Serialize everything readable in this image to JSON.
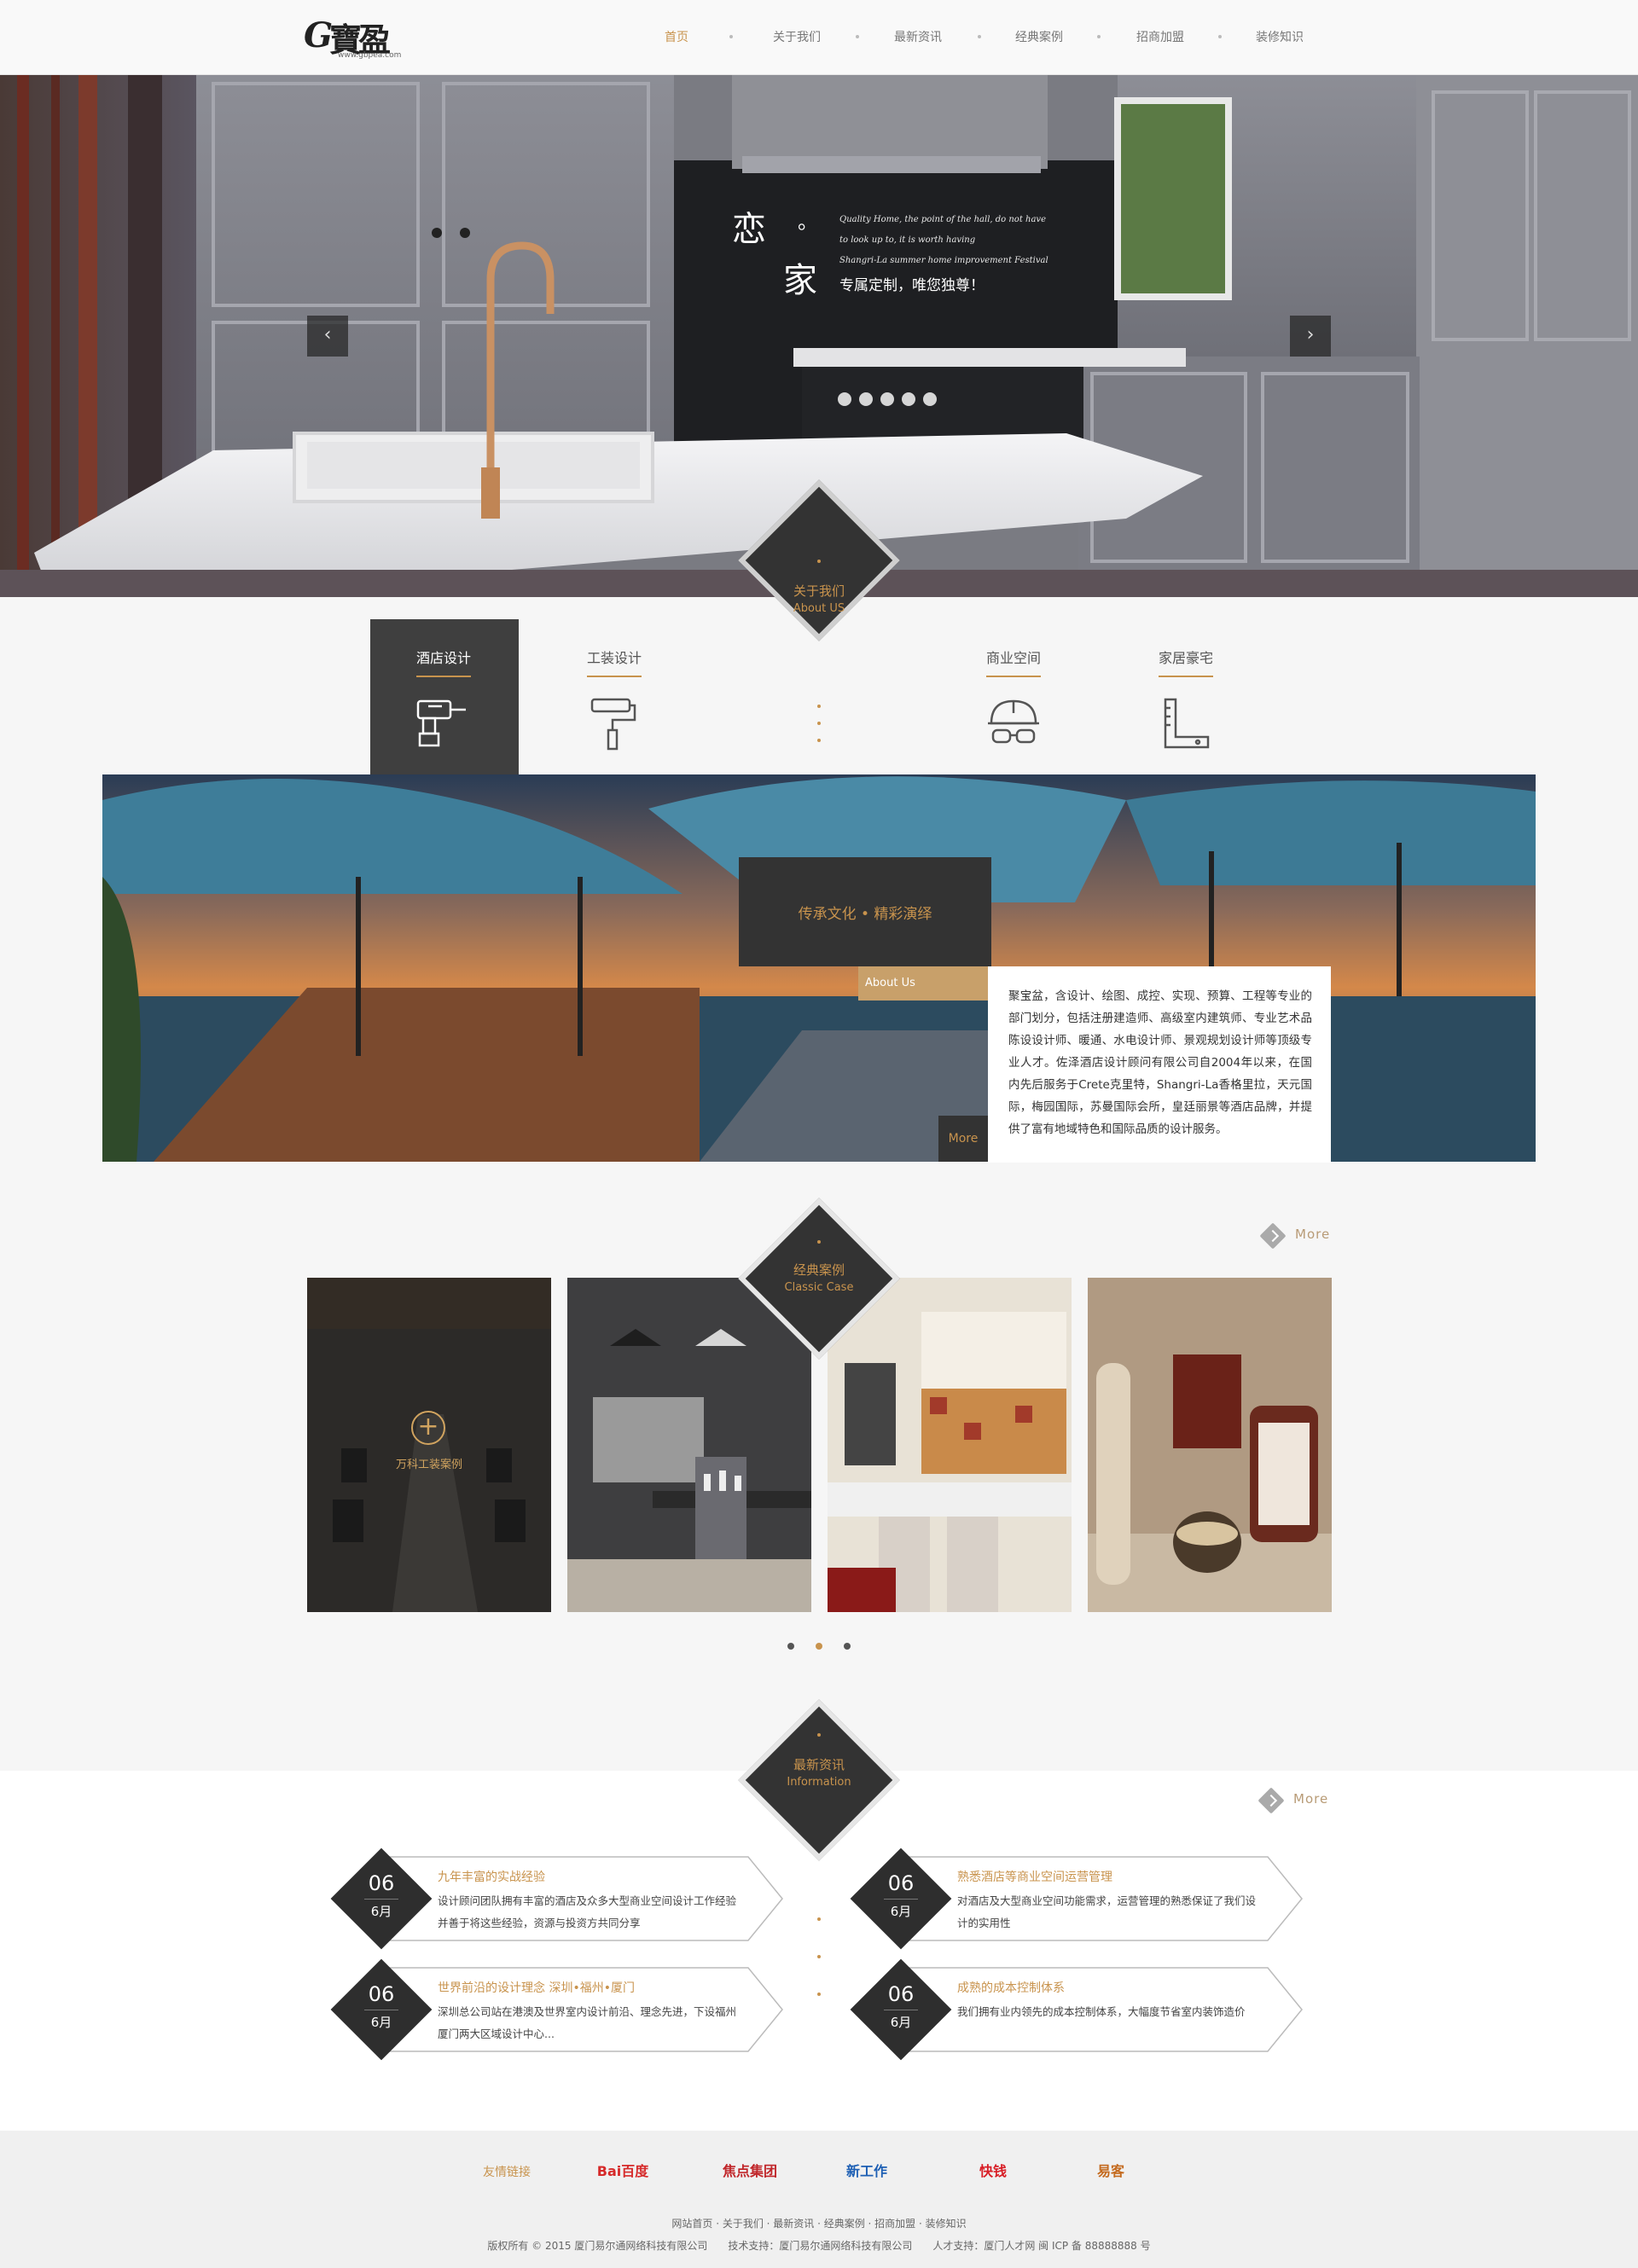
{
  "header": {
    "logo": {
      "latin": "G",
      "cn": "寶盈",
      "url": "www.gbpea.com"
    },
    "nav": [
      {
        "label": "首页",
        "active": true
      },
      {
        "label": "关于我们",
        "active": false
      },
      {
        "label": "最新资讯",
        "active": false
      },
      {
        "label": "经典案例",
        "active": false
      },
      {
        "label": "招商加盟",
        "active": false
      },
      {
        "label": "装修知识",
        "active": false
      }
    ]
  },
  "hero": {
    "char1": "恋",
    "dot": "。",
    "char2": "家",
    "en_lines": [
      "Quality Home, the point of the hall, do not have",
      "to look up to, it is worth having",
      "Shangri-La summer home improvement Festival"
    ],
    "slogan": "专属定制，唯您独尊！",
    "prev_icon": "‹",
    "next_icon": "›"
  },
  "about_badge": {
    "cn": "关于我们",
    "en": "About US"
  },
  "services": [
    {
      "label": "酒店设计",
      "icon": "drill-icon",
      "active": true
    },
    {
      "label": "工装设计",
      "icon": "paint-roller-icon",
      "active": false
    },
    {
      "label": "商业空间",
      "icon": "helmet-icon",
      "active": false
    },
    {
      "label": "家居豪宅",
      "icon": "ruler-icon",
      "active": false
    }
  ],
  "about": {
    "title": "传承文化 • 精彩演绎",
    "tag": "About Us",
    "more": "More",
    "text": "聚宝盆，含设计、绘图、成控、实现、预算、工程等专业的部门划分，包括注册建造师、高级室内建筑师、专业艺术品陈设设计师、暖通、水电设计师、景观规划设计师等顶级专业人才。佐泽酒店设计顾问有限公司自2004年以来，在国内先后服务于Crete克里特，Shangri-La香格里拉，天元国际，梅园国际，苏曼国际会所，皇廷丽景等酒店品牌，并提供了富有地域特色和国际品质的设计服务。"
  },
  "cases": {
    "badge_cn": "经典案例",
    "badge_en": "Classic Case",
    "more": "More",
    "items": [
      {
        "caption": "万科工装案例",
        "hover": true
      },
      {
        "caption": "",
        "hover": false
      },
      {
        "caption": "",
        "hover": false
      },
      {
        "caption": "",
        "hover": false
      }
    ],
    "pager": {
      "pages": 3,
      "current": 2
    }
  },
  "news": {
    "badge_cn": "最新资讯",
    "badge_en": "Information",
    "more": "More",
    "items": [
      {
        "day": "06",
        "month": "6月",
        "title": "九年丰富的实战经验",
        "desc": "设计顾问团队拥有丰富的酒店及众多大型商业空间设计工作经验并善于将这些经验，资源与投资方共同分享"
      },
      {
        "day": "06",
        "month": "6月",
        "title": "熟悉酒店等商业空间运营管理",
        "desc": "对酒店及大型商业空间功能需求，运营管理的熟悉保证了我们设计的实用性"
      },
      {
        "day": "06",
        "month": "6月",
        "title": "世界前沿的设计理念 深圳•福州•厦门",
        "desc": "深圳总公司站在港澳及世界室内设计前沿、理念先进，下设福州厦门两大区域设计中心..."
      },
      {
        "day": "06",
        "month": "6月",
        "title": "成熟的成本控制体系",
        "desc": "我们拥有业内领先的成本控制体系，大幅度节省室内装饰造价"
      }
    ]
  },
  "footer": {
    "friend_links_label": "友情链接",
    "partners": [
      "Bai百度",
      "焦点集团",
      "新工作",
      "快钱",
      "易客"
    ],
    "nav_line": "网站首页 · 关于我们 · 最新资讯 · 经典案例 · 招商加盟 · 装修知识",
    "copyright": "版权所有 © 2015 厦门易尔通网络科技有限公司　　技术支持：厦门易尔通网络科技有限公司　　人才支持：厦门人才网 闽 ICP 备 88888888 号"
  },
  "colors": {
    "accent": "#c8934d",
    "dark": "#333333",
    "bg": "#f6f6f6"
  }
}
